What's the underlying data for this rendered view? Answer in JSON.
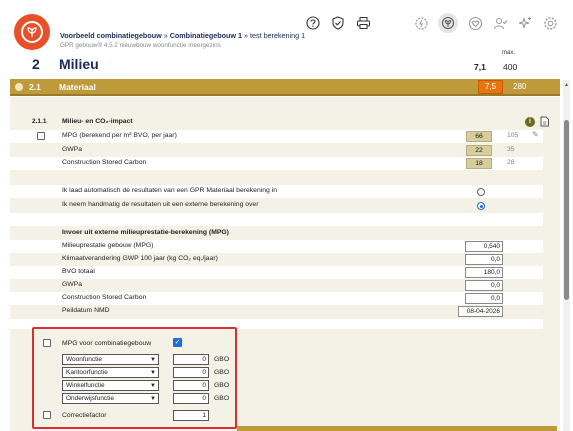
{
  "header": {
    "breadcrumb_project": "Voorbeeld combinatiegebouw",
    "breadcrumb_sep1": "»",
    "breadcrumb_building": "Combinatiegebouw 1",
    "breadcrumb_sep2": "»",
    "breadcrumb_calc": "test berekening 1",
    "subtitle": "GPR gebouw® 4.5.2 nieuwbouw woonfunctie meergezins",
    "section_number": "2",
    "section_title": "Milieu",
    "max_label": "max.",
    "score": "7,1",
    "max_score": "400"
  },
  "toolbar_icons": [
    "help-icon",
    "shield-check-icon",
    "print-icon"
  ],
  "module_icons": [
    "energy-gear-icon",
    "milieu-leaf-icon",
    "health-heart-icon",
    "user-quality-icon",
    "future-sparkle-icon",
    "settings-icon"
  ],
  "section": {
    "number": "2.1",
    "title": "Materiaal",
    "score": "7,5",
    "max": "280",
    "accent_color": "#bf9a3a",
    "score_color": "#e8740c"
  },
  "impact": {
    "number": "2.1.1",
    "title": "Milieu- en CO₂-impact",
    "rows": [
      {
        "label": "MPG (berekend per m² BVO, per jaar)",
        "score": "66",
        "max": "105"
      },
      {
        "label": "GWPa",
        "score": "22",
        "max": "35"
      },
      {
        "label": "Construction Stored Carbon",
        "score": "18",
        "max": "28"
      }
    ]
  },
  "options": {
    "auto_label": "Ik laad automatisch de resultaten van een GPR Materiaal berekening in",
    "manual_label": "Ik neem handmatig de resultaten uit een externe berekening over",
    "selected": "manual"
  },
  "external": {
    "heading": "Invoer uit externe milieuprestatie-berekening (MPG)",
    "fields": [
      {
        "label": "Milieuprestatie gebouw (MPG)",
        "value": "0,540"
      },
      {
        "label": "Klimaatverandering GWP 100 jaar (kg CO₂ eq./jaar)",
        "value": "0,0"
      },
      {
        "label": "BVO totaal",
        "value": "180,0"
      },
      {
        "label": "GWPa",
        "value": "0,0"
      },
      {
        "label": "Construction Stored Carbon",
        "value": "0,0"
      },
      {
        "label": "Peildatum NMD",
        "value": "08-04-2026"
      }
    ]
  },
  "combination": {
    "mpg_label": "MPG voor combinatiegebouw",
    "mpg_checked": true,
    "functions": [
      {
        "name": "Woonfunctie",
        "value": "0",
        "unit": "GBO"
      },
      {
        "name": "Kantoorfunctie",
        "value": "0",
        "unit": "GBO"
      },
      {
        "name": "Winkelfunctie",
        "value": "0",
        "unit": "GBO"
      },
      {
        "name": "Onderwijsfunctie",
        "value": "0",
        "unit": "GBO"
      }
    ],
    "correction_label": "Correctiefactor",
    "correction_value": "1"
  },
  "info_icon_label": "i"
}
